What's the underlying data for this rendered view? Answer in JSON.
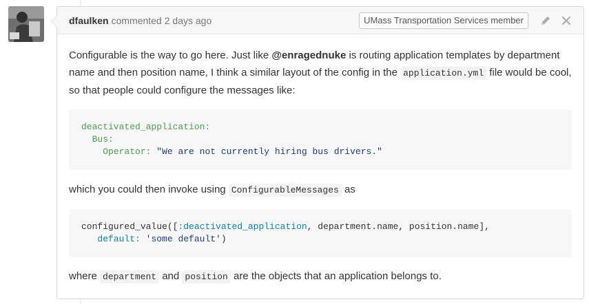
{
  "comment": {
    "author": "dfaulken",
    "action": "commented",
    "time": "2 days ago",
    "badge": "UMass Transportation Services member",
    "icons": {
      "edit": "pencil-icon",
      "close": "close-icon"
    },
    "para1": {
      "t1": "Configurable is the way to go here. Just like ",
      "mention": "@enragednuke",
      "t2": " is routing application templates by department name and then position name, I think a similar layout of the config in the ",
      "code": "application.yml",
      "t3": " file would be cool, so that people could configure the messages like:"
    },
    "yaml": {
      "line1_key": "deactivated_application:",
      "line2_key": "Bus:",
      "line3_key": "Operator:",
      "line3_val": "\"We are not currently hiring bus drivers.\""
    },
    "para2": {
      "t1": "which you could then invoke using ",
      "code": "ConfigurableMessages",
      "t2": " as"
    },
    "ruby": {
      "l1_a": "configured_value([",
      "l1_sym": ":deactivated_application",
      "l1_b": ", department.name, position.name],",
      "l2_key": "default:",
      "l2_str": "'some default'",
      "l2_end": ")"
    },
    "para3": {
      "t1": "where ",
      "code1": "department",
      "t2": " and ",
      "code2": "position",
      "t3": " are the objects that an application belongs to."
    }
  },
  "colors": {
    "header_bg": "#f7f7f7",
    "border": "#d8d8d8",
    "yaml_key": "#46a04a",
    "string": "#193e8c",
    "symbol": "#0086b3"
  }
}
